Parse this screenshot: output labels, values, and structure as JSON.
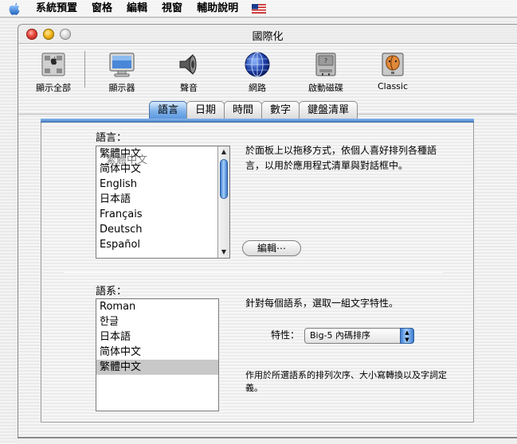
{
  "menubar": {
    "items": [
      "系統預置",
      "窗格",
      "編輯",
      "視窗",
      "輔助說明"
    ],
    "apple_icon": "apple-logo-icon",
    "flag_icon": "us-flag-icon"
  },
  "window": {
    "title": "國際化"
  },
  "toolbar": {
    "items": [
      {
        "label": "顯示全部",
        "icon": "show-all-icon"
      },
      {
        "label": "顯示器",
        "icon": "display-icon"
      },
      {
        "label": "聲音",
        "icon": "speaker-icon"
      },
      {
        "label": "網路",
        "icon": "globe-icon"
      },
      {
        "label": "啟動磁碟",
        "icon": "disk-icon"
      },
      {
        "label": "Classic",
        "icon": "classic-icon"
      }
    ]
  },
  "tabs": [
    {
      "label": "語言",
      "active": true
    },
    {
      "label": "日期",
      "active": false
    },
    {
      "label": "時間",
      "active": false
    },
    {
      "label": "數字",
      "active": false
    },
    {
      "label": "鍵盤清單",
      "active": false
    }
  ],
  "languages": {
    "label": "語言：",
    "items": [
      "繁體中文",
      "简体中文",
      "English",
      "日本語",
      "Français",
      "Deutsch",
      "Español"
    ],
    "dragging_item": "繁體中文",
    "description": "於面板上以拖移方式，依個人喜好排列各種語言，以用於應用程式清單與對話框中。",
    "edit_button": "編輯⋯"
  },
  "scripts": {
    "label": "語系：",
    "items": [
      "Roman",
      "한글",
      "日本語",
      "简体中文",
      "繁體中文"
    ],
    "selected_index": 4,
    "description": "針對每個語系，選取一組文字特性。",
    "behaviors_label": "特性：",
    "behaviors_value": "Big-5 內碼排序",
    "note": "作用於所選語系的排列次序、大小寫轉換以及字詞定義。"
  },
  "colors": {
    "accent": "#5c98de",
    "selection": "#c8c8c8"
  }
}
